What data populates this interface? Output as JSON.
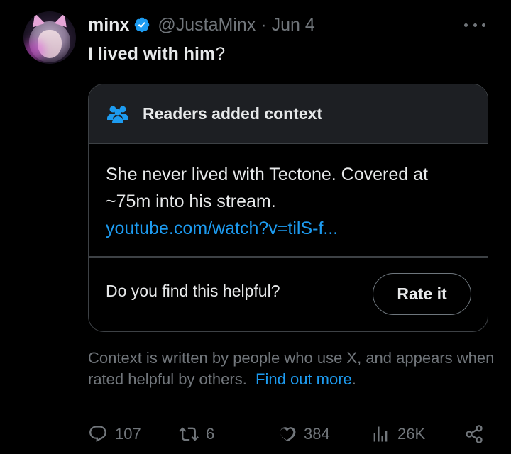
{
  "tweet": {
    "author_name": "minx",
    "verified": true,
    "handle": "@JustaMinx",
    "separator": "·",
    "date": "Jun 4",
    "text_bold": "I lived with him",
    "text_tail": "?"
  },
  "note": {
    "title": "Readers added context",
    "title_icon": "people-icon",
    "body": "She never lived with Tectone. Covered at ~75m into his stream.",
    "link": "youtube.com/watch?v=tilS-f...",
    "helpful_prompt": "Do you find this helpful?",
    "rate_button": "Rate it"
  },
  "disclaimer": {
    "text": "Context is written by people who use X, and appears when rated helpful by others.",
    "link": "Find out more",
    "period": "."
  },
  "actions": {
    "replies": "107",
    "reposts": "6",
    "likes": "384",
    "views": "26K"
  },
  "colors": {
    "background": "#000000",
    "text": "#e7e9ea",
    "muted": "#71767b",
    "link": "#1d9bf0",
    "note_header_bg": "#1d1f23",
    "border": "#3d4145"
  }
}
